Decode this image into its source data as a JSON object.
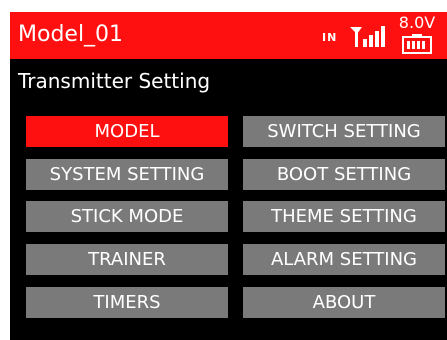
{
  "header": {
    "model_name": "Model_01",
    "signal_label": "IN",
    "signal_icon": "signal-bars-icon",
    "battery_voltage": "8.0V",
    "battery_icon": "battery-icon",
    "background_color": "#ff1010"
  },
  "page": {
    "title": "Transmitter Setting"
  },
  "menu": {
    "selected_color": "#ff1010",
    "default_color": "#7a7a7a",
    "left": [
      {
        "label": "MODEL",
        "selected": true
      },
      {
        "label": "SYSTEM SETTING",
        "selected": false
      },
      {
        "label": "STICK MODE",
        "selected": false
      },
      {
        "label": "TRAINER",
        "selected": false
      },
      {
        "label": "TIMERS",
        "selected": false
      }
    ],
    "right": [
      {
        "label": "SWITCH SETTING",
        "selected": false
      },
      {
        "label": "BOOT SETTING",
        "selected": false
      },
      {
        "label": "THEME SETTING",
        "selected": false
      },
      {
        "label": "ALARM SETTING",
        "selected": false
      },
      {
        "label": "ABOUT",
        "selected": false
      }
    ]
  }
}
